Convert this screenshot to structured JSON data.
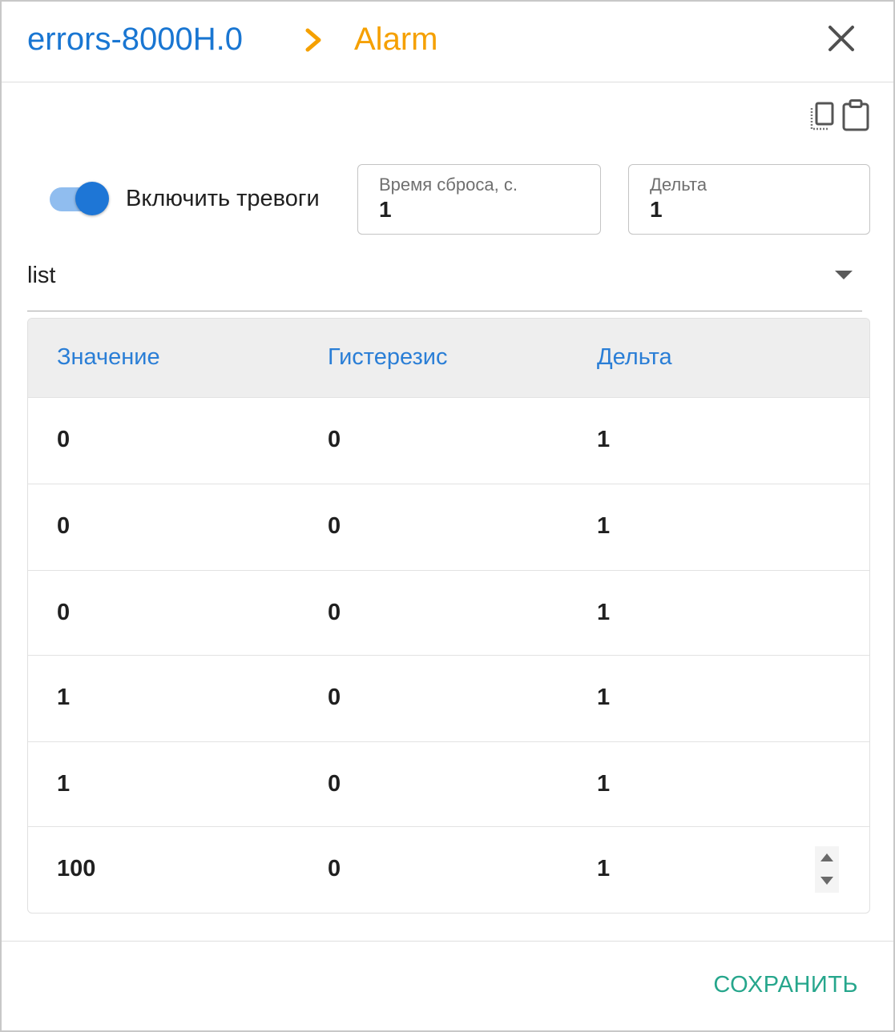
{
  "header": {
    "breadcrumb_root": "errors-8000H.0",
    "breadcrumb_current": "Alarm"
  },
  "toolbar": {
    "copy_icon": "copy-icon",
    "paste_icon": "clipboard-icon"
  },
  "alarms": {
    "enabled": true,
    "toggle_label": "Включить тревоги",
    "reset_time": {
      "label": "Время сброса, с.",
      "value": "1"
    },
    "delta": {
      "label": "Дельта",
      "value": "1"
    },
    "mode": {
      "value": "list"
    }
  },
  "table": {
    "columns": [
      "Значение",
      "Гистерезис",
      "Дельта"
    ],
    "rows": [
      [
        "0",
        "0",
        "1"
      ],
      [
        "0",
        "0",
        "1"
      ],
      [
        "0",
        "0",
        "1"
      ],
      [
        "1",
        "0",
        "1"
      ],
      [
        "1",
        "0",
        "1"
      ],
      [
        "100",
        "0",
        "1"
      ]
    ]
  },
  "footer": {
    "save_label": "СОХРАНИТЬ"
  },
  "colors": {
    "breadcrumb_root": "#1976d2",
    "breadcrumb_current": "#f5a000",
    "accent": "#1e76d6",
    "save": "#26a68c"
  }
}
